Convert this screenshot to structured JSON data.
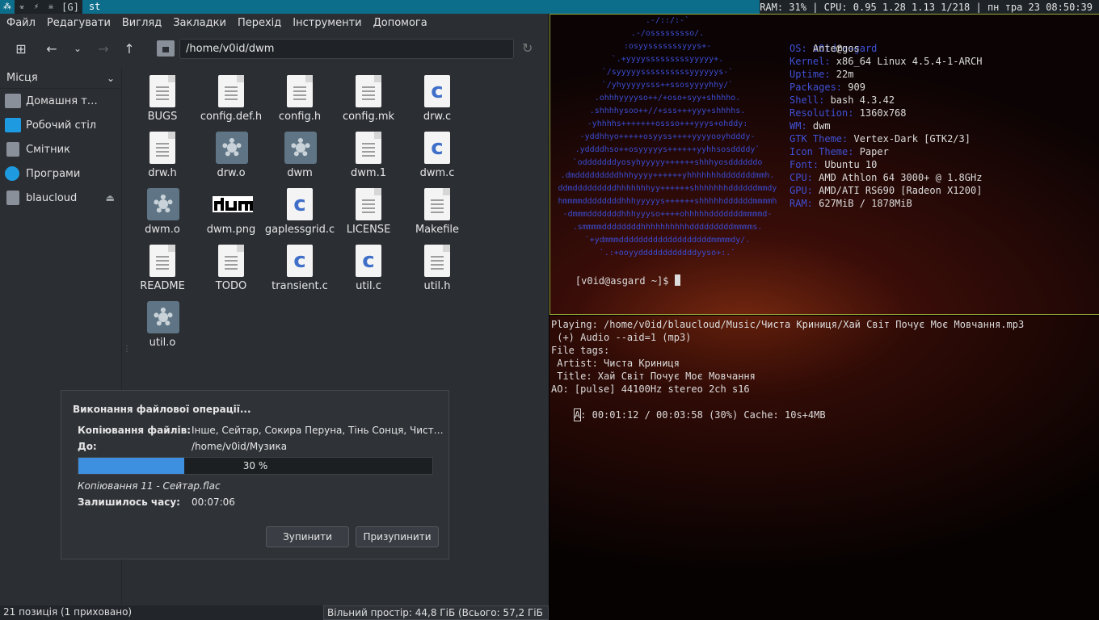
{
  "bar": {
    "tags": [
      "⁂",
      "☣",
      "⚡",
      "☠",
      "[G]"
    ],
    "window_title": "st",
    "status": "RAM: 31% | CPU: 0.95 1.28 1.13 1/218 | пн тра 23 08:50:39"
  },
  "fm": {
    "menu": [
      "Файл",
      "Редагувати",
      "Вигляд",
      "Закладки",
      "Перехід",
      "Інструменти",
      "Допомога"
    ],
    "path": "/home/v0id/dwm",
    "sidebar": {
      "title": "Місця",
      "items": [
        {
          "label": "Домашня т…",
          "icon": "home-folder-icon",
          "color": "#8a9099"
        },
        {
          "label": "Робочий стіл",
          "icon": "desktop-icon",
          "color": "#1e9be0"
        },
        {
          "label": "Смітник",
          "icon": "trash-icon",
          "color": "#8a9099"
        },
        {
          "label": "Програми",
          "icon": "applications-icon",
          "color": "#1e9be0"
        },
        {
          "label": "blaucloud",
          "icon": "drive-icon",
          "color": "#8a9099"
        }
      ]
    },
    "files": [
      {
        "name": "BUGS",
        "type": "text"
      },
      {
        "name": "config.def.h",
        "type": "text"
      },
      {
        "name": "config.h",
        "type": "text"
      },
      {
        "name": "config.mk",
        "type": "text"
      },
      {
        "name": "drw.c",
        "type": "c"
      },
      {
        "name": "drw.h",
        "type": "text"
      },
      {
        "name": "drw.o",
        "type": "binary"
      },
      {
        "name": "dwm",
        "type": "binary"
      },
      {
        "name": "dwm.1",
        "type": "text"
      },
      {
        "name": "dwm.c",
        "type": "c"
      },
      {
        "name": "dwm.o",
        "type": "binary"
      },
      {
        "name": "dwm.png",
        "type": "image"
      },
      {
        "name": "gaplessgrid.c",
        "type": "c"
      },
      {
        "name": "LICENSE",
        "type": "text"
      },
      {
        "name": "Makefile",
        "type": "text"
      },
      {
        "name": "README",
        "type": "text"
      },
      {
        "name": "TODO",
        "type": "text"
      },
      {
        "name": "transient.c",
        "type": "c"
      },
      {
        "name": "util.c",
        "type": "c"
      },
      {
        "name": "util.h",
        "type": "text"
      },
      {
        "name": "util.o",
        "type": "binary"
      }
    ],
    "status_left": "21 позиція (1 приховано)",
    "status_right": "Вільний простір: 44,8 ГіБ (Всього: 57,2 ГіБ )"
  },
  "dialog": {
    "title": "Виконання файлової операції...",
    "copy_label": "Копіювання файлів:",
    "copy_value": "Інше, Сейтар, Сокира Перуна, Тінь Сонця, Чист…",
    "to_label": "До:",
    "to_value": "/home/v0id/Музика",
    "progress": 0.3,
    "progress_text": "30 %",
    "current": "Копіювання 11 - Сейтар.flac",
    "remaining_label": "Залишилось часу:",
    "remaining_value": "00:07:06",
    "stop_label": "Зупинити",
    "pause_label": "Призупинити"
  },
  "term1": {
    "userhost_user": "v0id",
    "userhost_at": "@",
    "userhost_host": "asgard",
    "info": [
      {
        "k": "OS:",
        "v": " Antergos"
      },
      {
        "k": "Kernel:",
        "v": " x86_64 Linux 4.5.4-1-ARCH"
      },
      {
        "k": "Uptime:",
        "v": " 22m"
      },
      {
        "k": "Packages:",
        "v": " 909"
      },
      {
        "k": "Shell:",
        "v": " bash 4.3.42"
      },
      {
        "k": "Resolution:",
        "v": " 1360x768"
      },
      {
        "k": "WM:",
        "v": " dwm"
      },
      {
        "k": "GTK Theme:",
        "v": " Vertex-Dark [GTK2/3]"
      },
      {
        "k": "Icon Theme:",
        "v": " Paper"
      },
      {
        "k": "Font:",
        "v": " Ubuntu 10"
      },
      {
        "k": "CPU:",
        "v": " AMD Athlon 64 3000+ @ 1.8GHz"
      },
      {
        "k": "GPU:",
        "v": " AMD/ATI RS690 [Radeon X1200]"
      },
      {
        "k": "RAM:",
        "v": " 627MiB / 1878MiB"
      }
    ],
    "prompt": "[v0id@asgard ~]$ ",
    "ascii": ".-/::/:-`\n.-/osssssssso/.\n:osyysssssssyyys+-\n`.+yyyysssssssssyyyyy+.\n`/syyyyyssssssssssyyyyyys-`\n`/yhyyyyysss++ssosyyyyhhy/`\n.ohhhyyyyso++/+oso+syy+shhhho.\n.shhhhysoo++//+sss+++yyy+shhhhs.\n-yhhhhs+++++++ossso+++yyys+ohddy:\n-yddhhyo+++++osyyss++++yyyyooyhdddy-\n.yddddhso++osyyyyys++++++yyhhsosddddy`\n`odddddddyosyhyyyyy++++++shhhyosddddddo\n.dmdddddddddhhhyyyy++++++yhhhhhhhdddddddmmh.\nddmdddddddddhhhhhhhyy++++++shhhhhhhddddddmmdy\nhmmmmddddddddhhhyyyyys++++++shhhhhddddddmmmmh\n-dmmmdddddddhhhyyyso++++ohhhhhdddddddmmmmd-\n.smmmmddddddddhhhhhhhhhhdddddddddmmmms.\n`+ydmmmdddddddddddddddddddmmmmdy/.\n`.:+ooyyddddddddddddyyso+:.`",
    "bg": "#140606"
  },
  "term2": {
    "lines": [
      "Playing: /home/v0id/blaucloud/Music/Чиста Криниця/Хай Світ Почує Моє Мовчання.mp3",
      " (+) Audio --aid=1 (mp3)",
      "File tags:",
      " Artist: Чиста Криниця",
      " Title: Хай Світ Почує Моє Мовчання",
      "AO: [pulse] 44100Hz stereo 2ch s16"
    ],
    "status_prefix": "A",
    "status": ": 00:01:12 / 00:03:58 (30%) Cache: 10s+4MB"
  }
}
